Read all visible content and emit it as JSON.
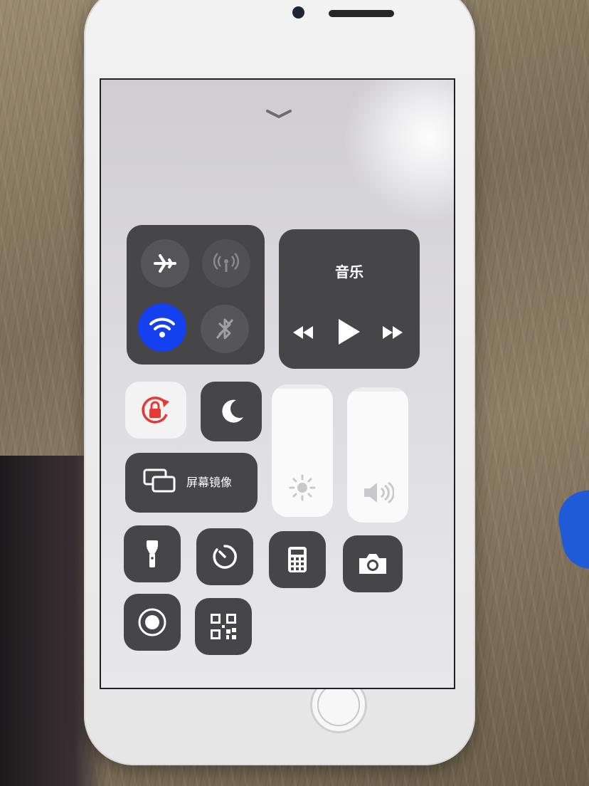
{
  "control_center": {
    "dismiss": {
      "icon": "chevron-down-icon"
    },
    "connectivity": {
      "airplane_mode": {
        "icon": "airplane-icon",
        "state": "off"
      },
      "cellular_data": {
        "icon": "cellular-antenna-icon",
        "state": "off"
      },
      "wifi": {
        "icon": "wifi-icon",
        "state": "on"
      },
      "bluetooth": {
        "icon": "bluetooth-icon",
        "state": "off"
      }
    },
    "music": {
      "title": "音乐",
      "controls": [
        "rewind-icon",
        "play-icon",
        "fast-forward-icon"
      ]
    },
    "orientation_lock": {
      "icon": "orientation-lock-icon",
      "state": "on"
    },
    "do_not_disturb": {
      "icon": "moon-icon",
      "state": "off"
    },
    "screen_mirroring": {
      "label": "屏幕镜像",
      "icon": "screen-mirroring-icon"
    },
    "brightness": {
      "icon": "sun-icon",
      "level": 0.97
    },
    "volume": {
      "icon": "speaker-icon",
      "level": 0.97
    },
    "shortcuts": [
      "flashlight-icon",
      "timer-icon",
      "calculator-icon",
      "camera-icon",
      "screen-record-icon",
      "qr-code-icon"
    ]
  },
  "colors": {
    "wifi_active": "#1440f0",
    "orientation_lock_red": "#e53935",
    "tile_dark": "#464649"
  }
}
